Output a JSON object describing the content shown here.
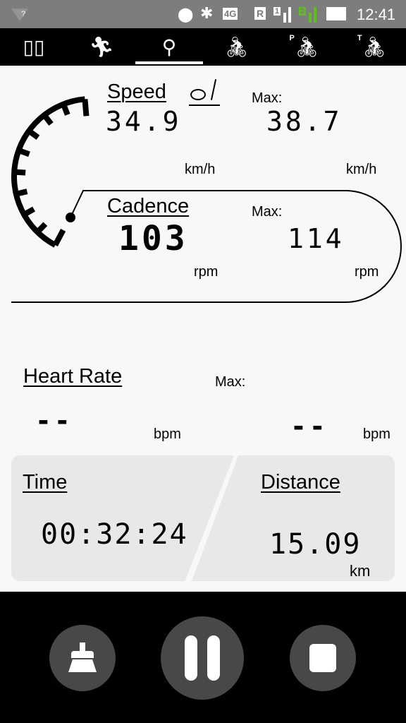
{
  "status_bar": {
    "time": "12:41",
    "network": "4G",
    "roaming": "R",
    "sim1": "1",
    "sim2": "2",
    "wifi_label": "?"
  },
  "tabs": [
    {
      "icon": "map-icon"
    },
    {
      "icon": "running-icon"
    },
    {
      "icon": "exercise-bike-icon",
      "selected": true
    },
    {
      "icon": "bicycle-icon"
    },
    {
      "icon": "bicycle-p-icon",
      "badge": "P"
    },
    {
      "icon": "bicycle-t-icon",
      "badge": "T"
    }
  ],
  "speed": {
    "label": "Speed",
    "value": "34.9",
    "max_label": "Max:",
    "max": "38.7",
    "unit": "km/h",
    "max_unit": "km/h"
  },
  "cadence": {
    "label": "Cadence",
    "value": "103",
    "max_label": "Max:",
    "max": "114",
    "unit": "rpm",
    "max_unit": "rpm"
  },
  "heart_rate": {
    "label": "Heart Rate",
    "value": "--",
    "max_label": "Max:",
    "max": "--",
    "unit": "bpm",
    "max_unit": "bpm"
  },
  "time": {
    "label": "Time",
    "value": "00:32:24"
  },
  "distance": {
    "label": "Distance",
    "value": "15.09",
    "unit": "km"
  },
  "controls": [
    {
      "icon": "broom-icon"
    },
    {
      "icon": "pause-icon"
    },
    {
      "icon": "stop-icon"
    }
  ]
}
